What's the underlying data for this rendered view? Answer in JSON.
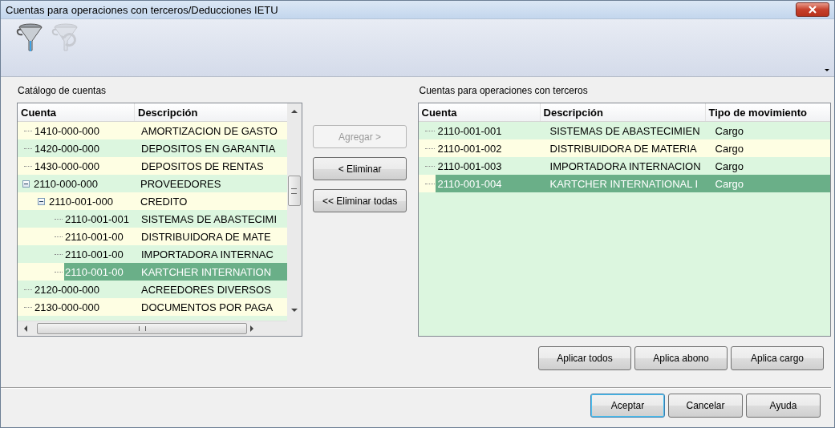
{
  "window": {
    "title": "Cuentas para operaciones con terceros/Deducciones IETU"
  },
  "toolbar": {
    "tools": [
      {
        "kind": "filter",
        "disabled": false
      },
      {
        "kind": "clear-filter",
        "disabled": true
      }
    ]
  },
  "catalog": {
    "label": "Catálogo de cuentas",
    "columns": [
      "Cuenta",
      "Descripción"
    ],
    "rows": [
      {
        "cuenta": "1410-000-000",
        "descripcion": "AMORTIZACION DE GASTO",
        "selected": false
      },
      {
        "cuenta": "1420-000-000",
        "descripcion": "DEPOSITOS EN GARANTIA",
        "selected": false
      },
      {
        "cuenta": "1430-000-000",
        "descripcion": "DEPOSITOS DE RENTAS",
        "selected": false
      },
      {
        "cuenta": "2110-000-000",
        "descripcion": "PROVEEDORES",
        "selected": false,
        "expanded": true,
        "children": [
          {
            "cuenta": "2110-001-000",
            "descripcion": "CREDITO",
            "selected": false,
            "expanded": true,
            "children": [
              {
                "cuenta": "2110-001-001",
                "descripcion": "SISTEMAS DE ABASTECIMI",
                "selected": false
              },
              {
                "cuenta": "2110-001-00",
                "descripcion": "DISTRIBUIDORA DE MATE",
                "selected": false
              },
              {
                "cuenta": "2110-001-00",
                "descripcion": "IMPORTADORA INTERNAC",
                "selected": false
              },
              {
                "cuenta": "2110-001-00",
                "descripcion": "KARTCHER INTERNATION",
                "selected": true
              }
            ]
          }
        ]
      },
      {
        "cuenta": "2120-000-000",
        "descripcion": "ACREEDORES DIVERSOS",
        "selected": false
      },
      {
        "cuenta": "2130-000-000",
        "descripcion": "DOCUMENTOS POR PAGA",
        "selected": false
      }
    ]
  },
  "transfer_buttons": [
    {
      "label": "Agregar >",
      "disabled": true
    },
    {
      "label": "< Eliminar",
      "disabled": false
    },
    {
      "label": "<< Eliminar todas",
      "disabled": false
    }
  ],
  "selected_accounts": {
    "label": "Cuentas para operaciones con terceros",
    "columns": [
      "Cuenta",
      "Descripción",
      "Tipo de movimiento"
    ],
    "rows": [
      {
        "cuenta": "2110-001-001",
        "descripcion": "SISTEMAS DE ABASTECIMIEN",
        "tipo": "Cargo",
        "selected": false
      },
      {
        "cuenta": "2110-001-002",
        "descripcion": "DISTRIBUIDORA DE MATERIA",
        "tipo": "Cargo",
        "selected": false
      },
      {
        "cuenta": "2110-001-003",
        "descripcion": "IMPORTADORA INTERNACION",
        "tipo": "Cargo",
        "selected": false
      },
      {
        "cuenta": "2110-001-004",
        "descripcion": "KARTCHER INTERNATIONAL I",
        "tipo": "Cargo",
        "selected": true
      }
    ]
  },
  "apply_buttons": [
    {
      "label": "Aplicar todos"
    },
    {
      "label": "Aplica abono"
    },
    {
      "label": "Aplica cargo"
    }
  ],
  "dialog_buttons": [
    {
      "label": "Aceptar",
      "default": true
    },
    {
      "label": "Cancelar",
      "default": false
    },
    {
      "label": "Ayuda",
      "default": false
    }
  ]
}
